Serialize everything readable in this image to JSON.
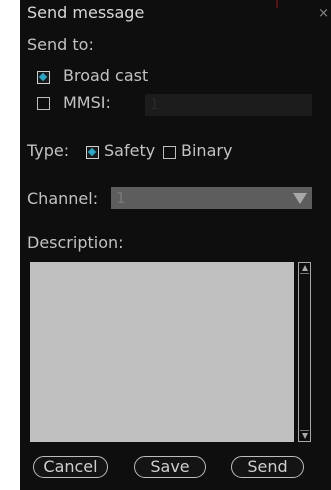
{
  "dialog": {
    "title": "Send message",
    "close_glyph": "×"
  },
  "send_to": {
    "label": "Send to:",
    "broadcast_label": "Broad cast",
    "broadcast_checked": true,
    "mmsi_label": "MMSI:",
    "mmsi_checked": false,
    "mmsi_value": "1"
  },
  "type": {
    "label": "Type:",
    "safety_label": "Safety",
    "safety_checked": true,
    "binary_label": "Binary",
    "binary_checked": false
  },
  "channel": {
    "label": "Channel:",
    "value": "1"
  },
  "description": {
    "label": "Description:",
    "value": ""
  },
  "buttons": {
    "cancel": "Cancel",
    "save": "Save",
    "send": "Send"
  },
  "colors": {
    "accent": "#2aa7c6",
    "background": "#0e0e0e",
    "text_area": "#c0c0c0"
  },
  "icons": {
    "checked": "checkbox-checked-icon",
    "unchecked": "checkbox-unchecked-icon",
    "dropdown": "chevron-down-icon",
    "close": "close-icon"
  }
}
